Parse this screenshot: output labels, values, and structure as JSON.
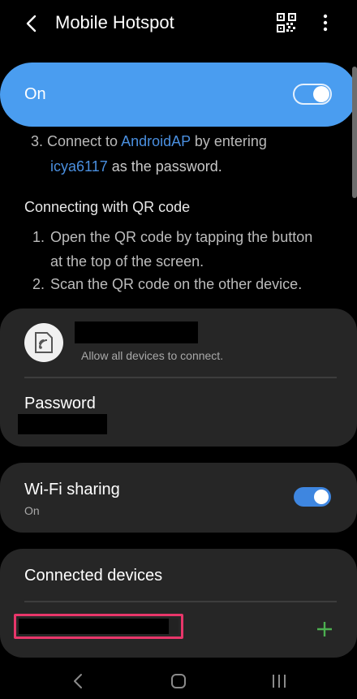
{
  "header": {
    "title": "Mobile Hotspot",
    "back_icon": "chevron-left-icon",
    "qr_icon": "qr-code-icon",
    "more_icon": "more-vertical-icon"
  },
  "master_switch": {
    "label": "On",
    "state": "on",
    "color": "#4a9df0"
  },
  "instructions": {
    "cut_line_prefix": "3. Connect to ",
    "cut_line_network": "AndroidAP",
    "cut_line_suffix": " by entering",
    "password_value": "icya6117",
    "password_suffix": " as the password.",
    "qr_heading": "Connecting with QR code",
    "steps": [
      {
        "num": "1.",
        "text": "Open the QR code by tapping the button at the top of the screen."
      },
      {
        "num": "2.",
        "text": "Scan the QR code on the other device."
      }
    ]
  },
  "network_card": {
    "icon": "hotspot-device-icon",
    "allow_text": "Allow all devices to connect.",
    "password_label": "Password"
  },
  "wifi_sharing": {
    "title": "Wi-Fi sharing",
    "status": "On",
    "state": "on"
  },
  "connected_devices": {
    "title": "Connected devices",
    "add_icon": "plus-icon",
    "accent_color": "#4caf50",
    "highlight_color": "#e8366a"
  },
  "navbar": {
    "back_icon": "nav-back-icon",
    "home_icon": "nav-home-icon",
    "recent_icon": "nav-recent-apps-icon"
  }
}
